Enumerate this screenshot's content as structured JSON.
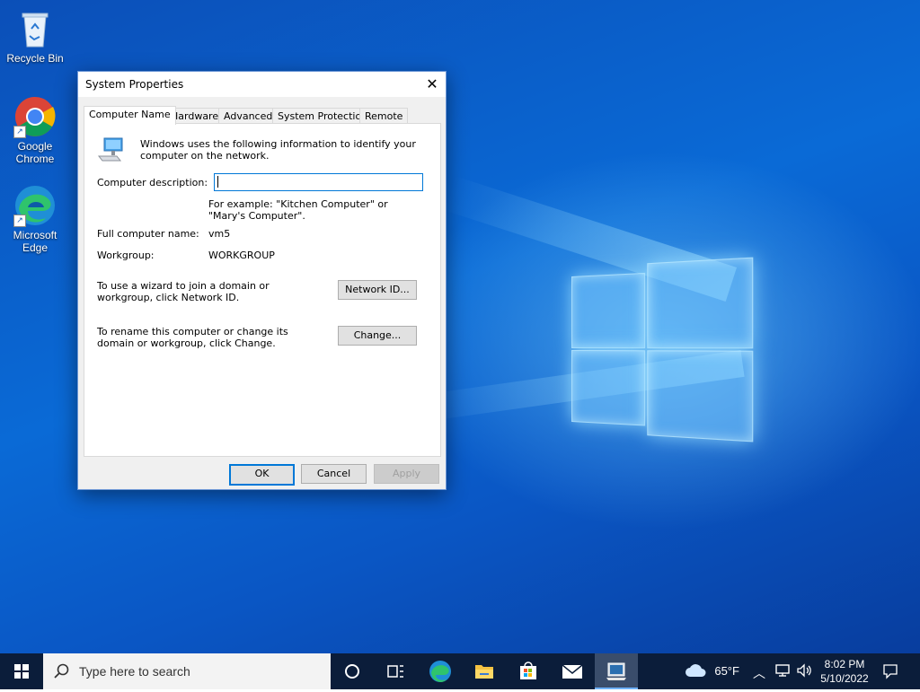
{
  "desktop": {
    "icons": [
      {
        "label": "Recycle Bin"
      },
      {
        "label": "Google Chrome"
      },
      {
        "label": "Microsoft Edge"
      }
    ]
  },
  "dialog": {
    "title": "System Properties",
    "close_glyph": "✕",
    "tabs": [
      "Computer Name",
      "Hardware",
      "Advanced",
      "System Protection",
      "Remote"
    ],
    "active_tab": "Computer Name",
    "intro": "Windows uses the following information to identify your computer on the network.",
    "description_label": "Computer description:",
    "description_value": "",
    "example": "For example: \"Kitchen Computer\" or \"Mary's Computer\".",
    "full_name_label": "Full computer name:",
    "full_name_value": "vm5",
    "workgroup_label": "Workgroup:",
    "workgroup_value": "WORKGROUP",
    "network_id_text": "To use a wizard to join a domain or workgroup, click Network ID.",
    "network_id_button": "Network ID...",
    "change_text": "To rename this computer or change its domain or workgroup, click Change.",
    "change_button": "Change...",
    "ok": "OK",
    "cancel": "Cancel",
    "apply": "Apply"
  },
  "taskbar": {
    "search_placeholder": "Type here to search",
    "weather": "65°F",
    "time": "8:02 PM",
    "date": "5/10/2022",
    "accent": "#0078d7"
  }
}
